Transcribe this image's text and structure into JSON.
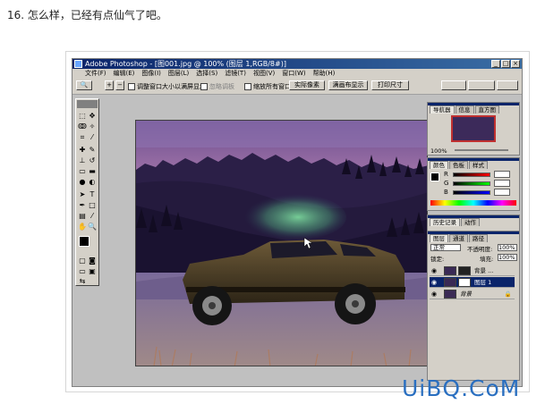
{
  "caption": "16. 怎么样，已经有点仙气了吧。",
  "app": {
    "title": "Adobe Photoshop - [图001.jpg @ 100% (图层 1,RGB/8#)]",
    "window_buttons": [
      "_",
      "□",
      "×"
    ]
  },
  "menu": [
    "文件(F)",
    "编辑(E)",
    "图像(I)",
    "图层(L)",
    "选择(S)",
    "滤镜(T)",
    "视图(V)",
    "窗口(W)",
    "帮助(H)"
  ],
  "options": {
    "resize_window": "调整窗口大小以满屏显示",
    "ignore_palettes": "忽略调板",
    "zoom_all_windows": "缩放所有窗口",
    "actual_pixels": "实际像素",
    "fit_on_screen": "满画布显示",
    "print_size": "打印尺寸",
    "zoom_symbols": [
      "+",
      "−"
    ]
  },
  "panels": {
    "navigator": {
      "tabs": [
        "导航器",
        "信息",
        "直方图"
      ],
      "zoom": "100%"
    },
    "color": {
      "tabs": [
        "颜色",
        "色板",
        "样式"
      ],
      "channels": [
        {
          "label": "R",
          "value": "",
          "color": "#b22222"
        },
        {
          "label": "G",
          "value": "",
          "color": "#2e8b57"
        },
        {
          "label": "B",
          "value": "",
          "color": "#1e3ca0"
        }
      ]
    },
    "history": {
      "tabs": [
        "历史记录",
        "动作"
      ]
    },
    "layers": {
      "tabs": [
        "图层",
        "通道",
        "路径"
      ],
      "blend_mode": "正常",
      "opacity_label": "不透明度:",
      "opacity_value": "100%",
      "lock_label": "锁定:",
      "fill_label": "填充:",
      "fill_value": "100%",
      "rows": [
        {
          "name": "背景 ..."
        },
        {
          "name": "图层 1"
        },
        {
          "name": "背景"
        }
      ]
    }
  },
  "watermark": "UiBQ.CoM",
  "colors": {
    "title_bar": "#0a246a",
    "chrome": "#d4d0c8",
    "selected_layer": "#0a246a",
    "watermark": "#2a6fc0"
  }
}
